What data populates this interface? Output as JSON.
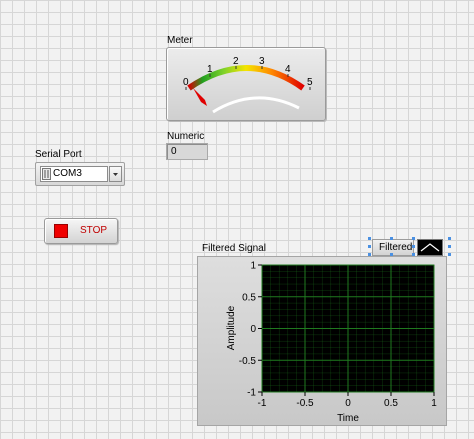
{
  "meter": {
    "label": "Meter",
    "scale_labels": [
      "0",
      "1",
      "2",
      "3",
      "4",
      "5"
    ],
    "value": 0
  },
  "numeric": {
    "label": "Numeric",
    "value": "0"
  },
  "serial_port": {
    "label": "Serial Port",
    "value": "COM3"
  },
  "stop_button": {
    "label": "STOP"
  },
  "graph": {
    "title": "Filtered Signal",
    "legend_name": "Filtered",
    "xlabel": "Time",
    "ylabel": "Amplitude",
    "x_ticks": [
      "-1",
      "-0.5",
      "0",
      "0.5",
      "1"
    ],
    "y_ticks": [
      "1",
      "0.5",
      "0",
      "-0.5",
      "-1"
    ],
    "colors": {
      "plot_background": "#000000",
      "grid": "#1f7a1f"
    }
  },
  "chart_data": {
    "type": "line",
    "title": "Filtered Signal",
    "xlabel": "Time",
    "ylabel": "Amplitude",
    "xlim": [
      -1,
      1
    ],
    "ylim": [
      -1,
      1
    ],
    "x_ticks": [
      -1,
      -0.5,
      0,
      0.5,
      1
    ],
    "y_ticks": [
      -1,
      -0.5,
      0,
      0.5,
      1
    ],
    "grid": true,
    "series": [
      {
        "name": "Filtered",
        "values": []
      }
    ]
  }
}
